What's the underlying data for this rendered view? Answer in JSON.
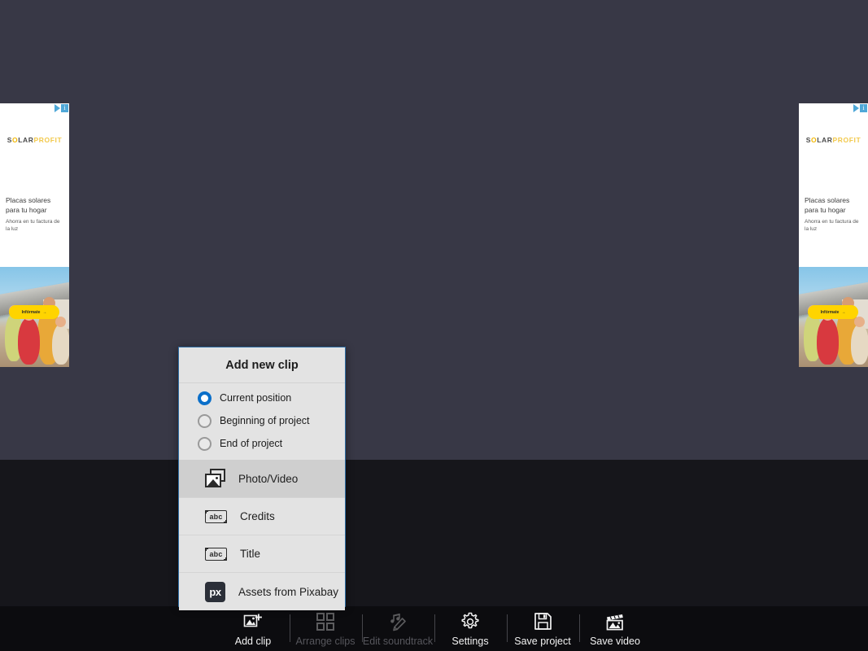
{
  "app": {
    "background_upper": "#383846",
    "background_lower": "#16161b",
    "accent": "#0b6fc9"
  },
  "ads": {
    "label": "advertisement-banner",
    "choices_label": "AdChoices",
    "brand_solar": "S",
    "brand_o": "O",
    "brand_lar": "LAR",
    "brand_profit": "PROFIT",
    "headline": "Placas solares para tu hogar",
    "subline": "Ahorra en tu factura de la luz",
    "cta": "Infórmate",
    "cta_arrow": "→"
  },
  "dialog": {
    "title": "Add new clip",
    "radio_options": [
      {
        "label": "Current position",
        "selected": true
      },
      {
        "label": "Beginning of project",
        "selected": false
      },
      {
        "label": "End of project",
        "selected": false
      }
    ],
    "menu_items": [
      {
        "label": "Photo/Video",
        "icon": "photo-video-icon",
        "hovered": true
      },
      {
        "label": "Credits",
        "icon": "abc-text-icon",
        "glyph": "abc",
        "hovered": false
      },
      {
        "label": "Title",
        "icon": "abc-text-icon",
        "glyph": "abc",
        "hovered": false
      },
      {
        "label": "Assets from Pixabay",
        "icon": "pixabay-icon",
        "glyph": "px",
        "hovered": false
      }
    ]
  },
  "toolbar": {
    "items": [
      {
        "label": "Add clip",
        "icon": "add-clip-icon",
        "enabled": true
      },
      {
        "label": "Arrange clips",
        "icon": "grid-squares-icon",
        "enabled": false
      },
      {
        "label": "Edit soundtrack",
        "icon": "music-pencil-icon",
        "enabled": false
      },
      {
        "label": "Settings",
        "icon": "gear-icon",
        "enabled": true
      },
      {
        "label": "Save project",
        "icon": "floppy-disk-icon",
        "enabled": true
      },
      {
        "label": "Save video",
        "icon": "clapperboard-icon",
        "enabled": true
      }
    ]
  }
}
